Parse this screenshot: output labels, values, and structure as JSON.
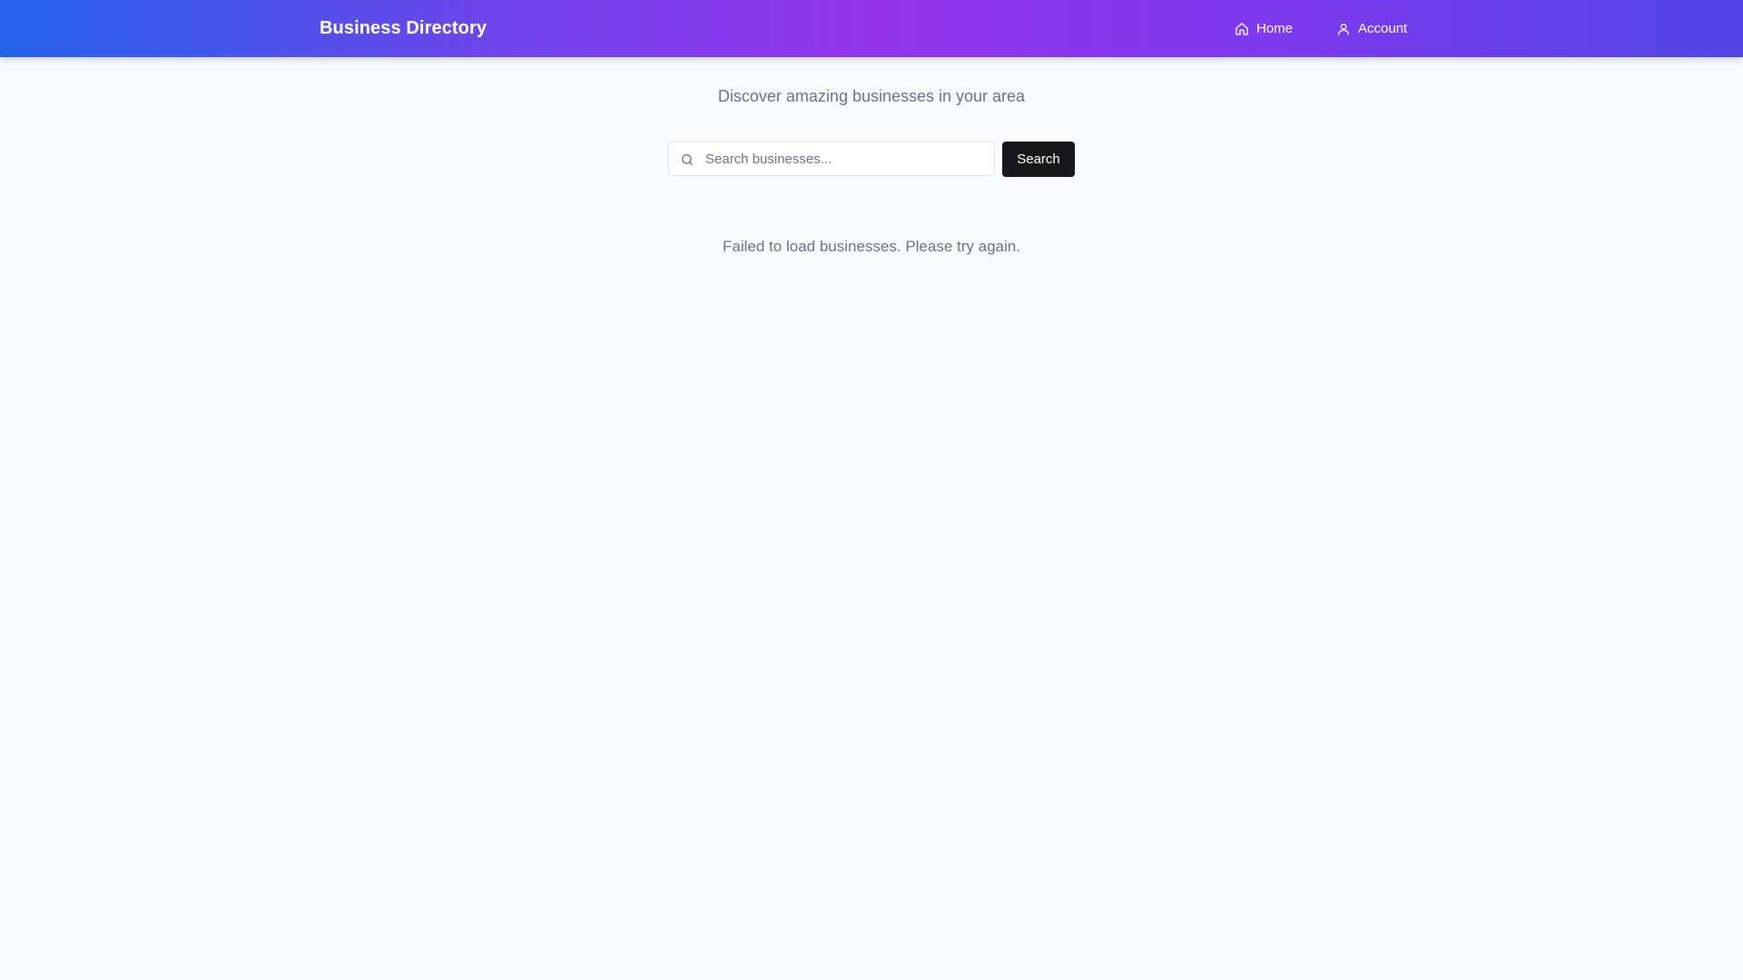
{
  "header": {
    "brand": "Business Directory",
    "nav": [
      {
        "label": "Home",
        "icon": "home-icon"
      },
      {
        "label": "Account",
        "icon": "user-icon"
      }
    ],
    "gradient_colors": [
      "#2563eb",
      "#9333ea",
      "#4f46e5"
    ]
  },
  "main": {
    "tagline": "Discover amazing businesses in your area",
    "search": {
      "placeholder": "Search businesses...",
      "value": "",
      "icon": "search-icon",
      "button_label": "Search"
    },
    "status_message": "Failed to load businesses. Please try again."
  }
}
